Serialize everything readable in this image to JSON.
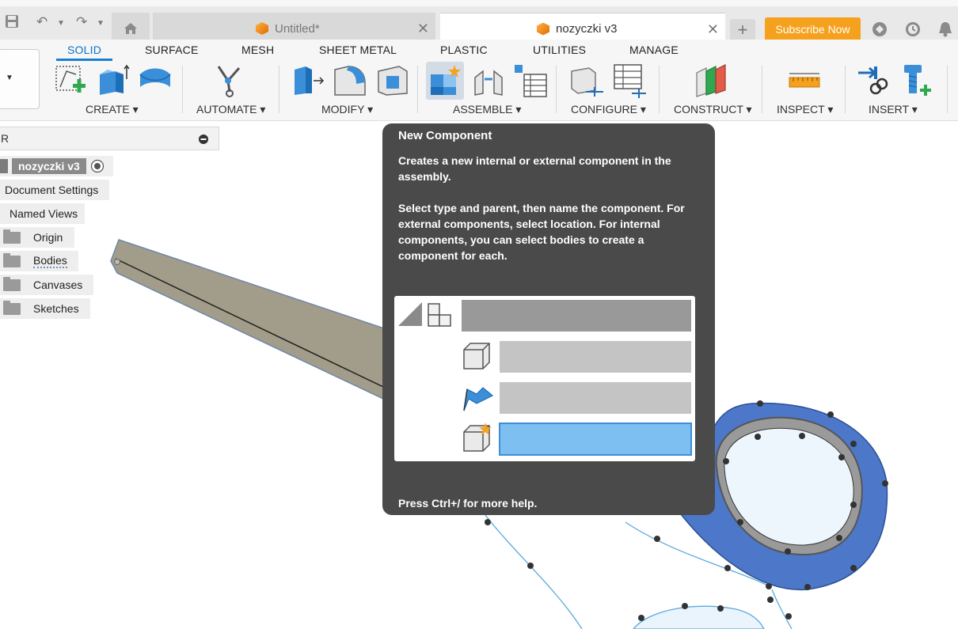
{
  "tabs": {
    "untitled": "Untitled*",
    "active": "nozyczki v3"
  },
  "subscribe_label": "Subscribe Now",
  "ribbon_tabs": [
    "SOLID",
    "SURFACE",
    "MESH",
    "SHEET METAL",
    "PLASTIC",
    "UTILITIES",
    "MANAGE"
  ],
  "groups": [
    "CREATE ▾",
    "AUTOMATE ▾",
    "MODIFY ▾",
    "ASSEMBLE ▾",
    "CONFIGURE ▾",
    "CONSTRUCT ▾",
    "INSPECT ▾",
    "INSERT ▾"
  ],
  "browser": {
    "search_text": "R",
    "root": "nozyczki v3",
    "items": [
      "Document Settings",
      "Named Views",
      "Origin",
      "Bodies",
      "Canvases",
      "Sketches"
    ]
  },
  "tooltip": {
    "title": "New Component",
    "description": "Creates a new internal or external component in the assembly.",
    "details": "Select type and parent, then name the component. For external components, select location. For internal components, you can select bodies to create a component for each.",
    "help": "Press Ctrl+/ for more help."
  },
  "colors": {
    "accent": "#1b7fd1",
    "subscribe": "#f5a11d",
    "tooltip_bg": "#4a4a4a",
    "blade": "#a29d8a",
    "handle": "#4d78c9"
  }
}
